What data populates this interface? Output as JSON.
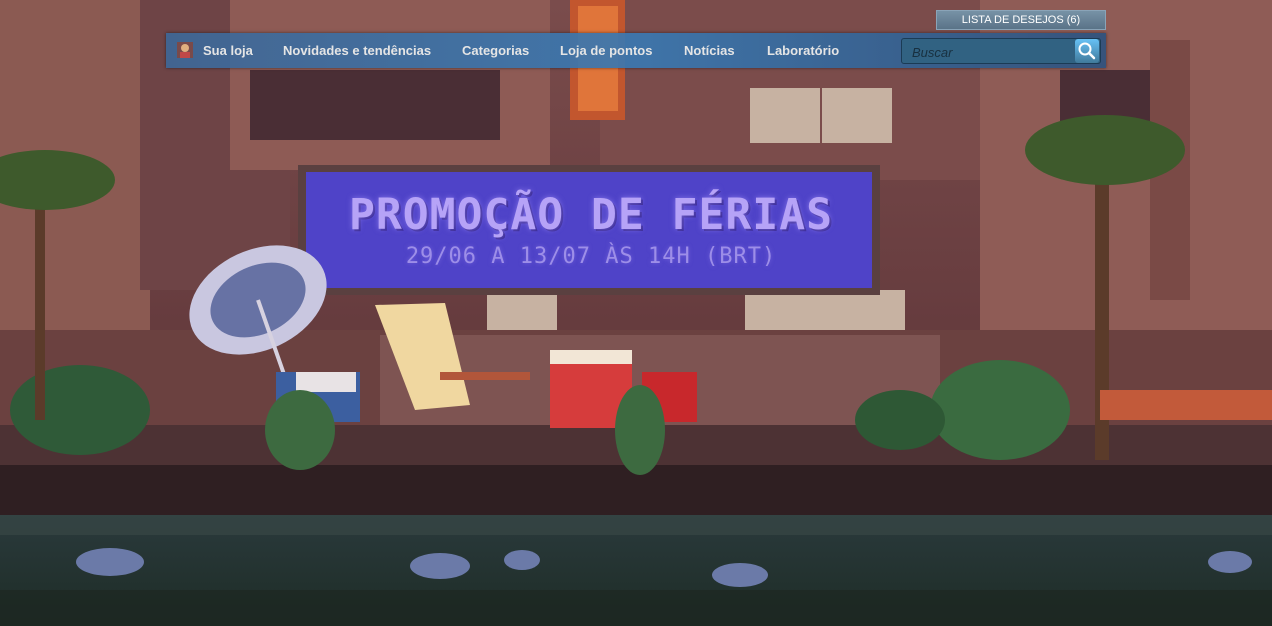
{
  "wishlist": {
    "label": "LISTA DE DESEJOS (6)"
  },
  "nav": {
    "items": [
      {
        "label": "Sua loja"
      },
      {
        "label": "Novidades e tendências"
      },
      {
        "label": "Categorias"
      },
      {
        "label": "Loja de pontos"
      },
      {
        "label": "Notícias"
      },
      {
        "label": "Laboratório"
      }
    ],
    "search_placeholder": "Buscar"
  },
  "banner": {
    "title": "PROMOÇÃO DE FÉRIAS",
    "dates": "29/06 A 13/07 ÀS 14H (BRT)"
  },
  "colors": {
    "nav_bg": "#3a78b1",
    "wishlist_bg": "#6b869b",
    "billboard": "#4b3fc0",
    "water": "#2d4a4a"
  }
}
